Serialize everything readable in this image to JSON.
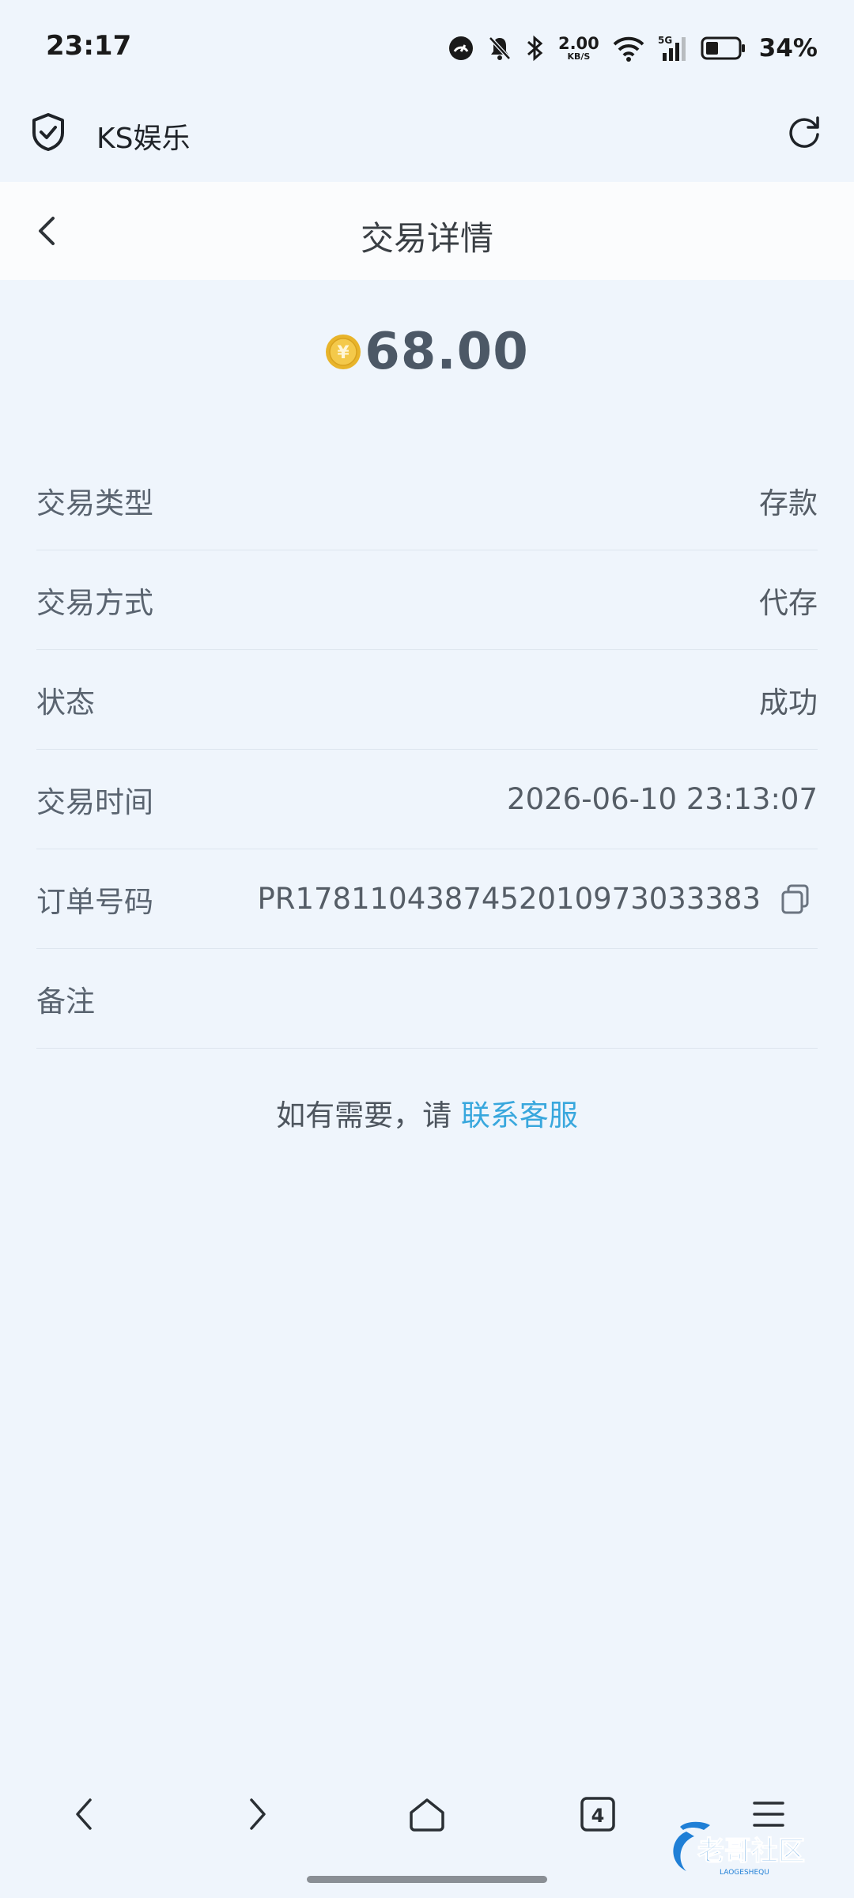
{
  "status_bar": {
    "time": "23:17",
    "net_speed_value": "2.00",
    "net_speed_unit": "KB/S",
    "signal_label": "5G",
    "battery_percent": "34%"
  },
  "browser": {
    "site_title": "KS娱乐",
    "tab_count": "4"
  },
  "header": {
    "title": "交易详情"
  },
  "amount": {
    "value": "68.00",
    "coin_symbol": "¥"
  },
  "details": [
    {
      "label": "交易类型",
      "value": "存款"
    },
    {
      "label": "交易方式",
      "value": "代存"
    },
    {
      "label": "状态",
      "value": "成功"
    },
    {
      "label": "交易时间",
      "value": "2026-06-10 23:13:07"
    },
    {
      "label": "订单号码",
      "value": "PR1781104387452010973033383"
    },
    {
      "label": "备注",
      "value": ""
    }
  ],
  "help": {
    "prefix": "如有需要，请 ",
    "link": "联系客服"
  },
  "watermark": {
    "text": "老哥社区",
    "sub": "LAOGESHEQU"
  },
  "colors": {
    "background": "#eff5fc",
    "link": "#38a7dd",
    "coin": "#e8b42a",
    "amount": "#4c5866"
  }
}
